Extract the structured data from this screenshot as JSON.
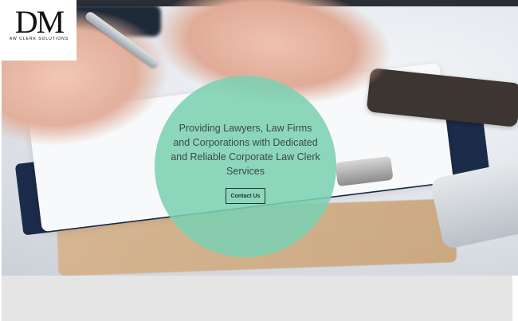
{
  "logo": {
    "letters": "DM",
    "subtitle": "AW CLERK SOLUTIONS"
  },
  "hero": {
    "tagline": "Providing Lawyers, Law Firms and Corporations with Dedicated and Reliable Corporate Law Clerk Services",
    "cta_label": "Contact Us"
  },
  "colors": {
    "circle": "#7cd0b2",
    "text": "#3c4a46",
    "band": "#e5e5e5"
  }
}
